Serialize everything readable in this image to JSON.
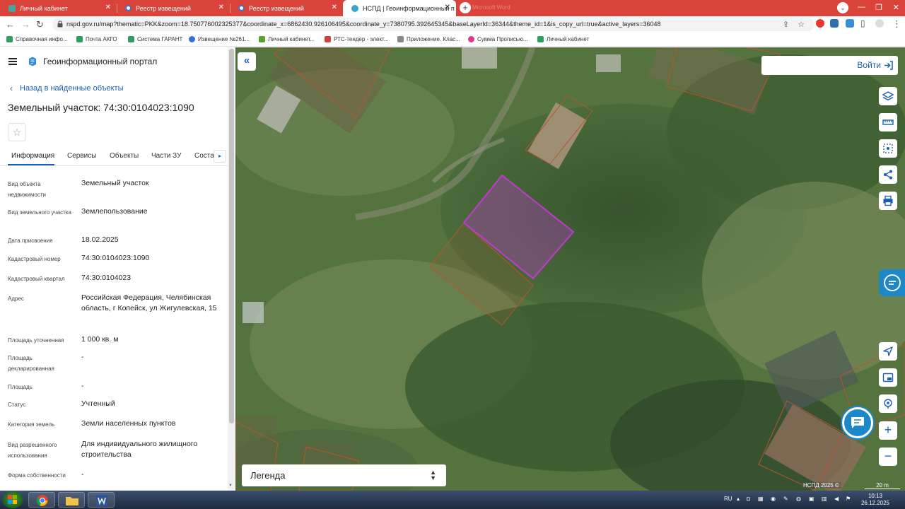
{
  "browser": {
    "tabs": [
      {
        "title": "Личный кабинет",
        "active": false
      },
      {
        "title": "Реестр извещений",
        "active": false
      },
      {
        "title": "Реестр извещений",
        "active": false
      },
      {
        "title": "НСПД | Геоинформационный п",
        "active": true
      }
    ],
    "ghost_tab": "Microsoft Word",
    "new_tab": "+",
    "url": "nspd.gov.ru/map?thematic=PKK&zoom=18.750776002325377&coordinate_x=6862430.926106495&coordinate_y=7380795.392645345&baseLayerId=36344&theme_id=1&is_copy_url=true&active_layers=36048",
    "bookmarks": [
      {
        "label": "Справочная инфо...",
        "color": "#2e9e62"
      },
      {
        "label": "Почта АКГО",
        "color": "#2e9e62"
      },
      {
        "label": "Система ГАРАНТ",
        "color": "#2e9e62"
      },
      {
        "label": "Извещение №261...",
        "color": "#3b6fd6"
      },
      {
        "label": "Личный кабинет...",
        "color": "#5aa02c"
      },
      {
        "label": "РТС-тендер - элект...",
        "color": "#d6403a"
      },
      {
        "label": "Приложение. Клас...",
        "color": "#888888"
      },
      {
        "label": "Сумма Прописью...",
        "color": "#d93a8f"
      },
      {
        "label": "Личный кабинет",
        "color": "#2e9e62"
      }
    ]
  },
  "portal": {
    "title": "Геоинформационный портал",
    "back_link": "Назад в найденные объекты",
    "parcel_title": "Земельный участок: 74:30:0104023:1090",
    "star": "☆",
    "tabs": [
      "Информация",
      "Сервисы",
      "Объекты",
      "Части ЗУ",
      "Соста"
    ],
    "properties": [
      {
        "label": "Вид объекта недвижимости",
        "value": "Земельный участок"
      },
      {
        "label": "Вид земельного участка",
        "value": "Землепользование"
      },
      {
        "label": "Дата присвоения",
        "value": "18.02.2025"
      },
      {
        "label": "Кадастровый номер",
        "value": "74:30:0104023:1090"
      },
      {
        "label": "Кадастровый квартал",
        "value": "74:30:0104023"
      },
      {
        "label": "Адрес",
        "value": "Российская Федерация, Челябинская область, г Копейск, ул Жигулевская, 15"
      },
      {
        "label": "Площадь уточненная",
        "value": "1 000 кв. м"
      },
      {
        "label": "Площадь декларированная",
        "value": "-"
      },
      {
        "label": "Площадь",
        "value": "-"
      },
      {
        "label": "Статус",
        "value": "Учтенный"
      },
      {
        "label": "Категория земель",
        "value": "Земли населенных пунктов"
      },
      {
        "label": "Вид разрешенного использования",
        "value": "Для индивидуального жилищного строительства"
      },
      {
        "label": "Форма собственности",
        "value": "-"
      }
    ]
  },
  "map": {
    "login_label": "Войти",
    "legend_label": "Легенда",
    "attribution": "НСПД 2025 ©",
    "scale_label": "20 m",
    "zoom_in": "+",
    "zoom_out": "−",
    "collapse": "«",
    "selected_color": "#c03ad0",
    "parcel_outline_color": "#b5562e"
  },
  "taskbar": {
    "lang": "RU",
    "time": "10:13",
    "date": "26.12.2025"
  }
}
